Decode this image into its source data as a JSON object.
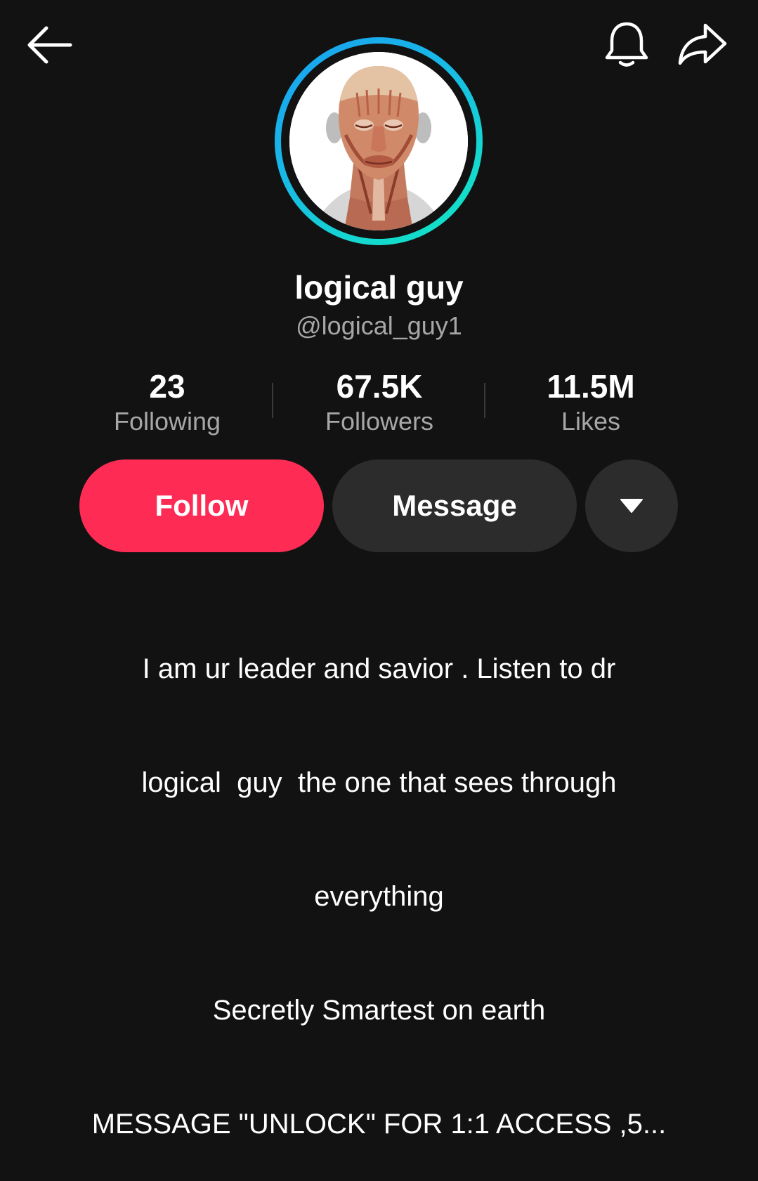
{
  "header": {
    "back_icon": "arrow-left-icon",
    "notification_icon": "bell-icon",
    "share_icon": "share-arrow-icon"
  },
  "profile": {
    "avatar_description": "anatomical face muscles illustration",
    "display_name": "logical guy",
    "handle": "@logical_guy1"
  },
  "stats": {
    "following": {
      "value": "23",
      "label": "Following"
    },
    "followers": {
      "value": "67.5K",
      "label": "Followers"
    },
    "likes": {
      "value": "11.5M",
      "label": "Likes"
    }
  },
  "actions": {
    "follow_label": "Follow",
    "message_label": "Message",
    "more_icon": "triangle-down-icon"
  },
  "bio": {
    "lines": [
      "I am ur leader and savior . Listen to dr",
      "logical  guy  the one that sees through",
      "everything",
      "Secretly Smartest on earth",
      "MESSAGE \"UNLOCK\" FOR 1:1 ACCESS ,5..."
    ]
  },
  "colors": {
    "background": "#121212",
    "follow_button": "#fe2c55",
    "secondary_button": "#2c2c2c",
    "muted_text": "#a7a7a7",
    "ring_start": "#1aa0f0",
    "ring_end": "#10e6c0"
  }
}
